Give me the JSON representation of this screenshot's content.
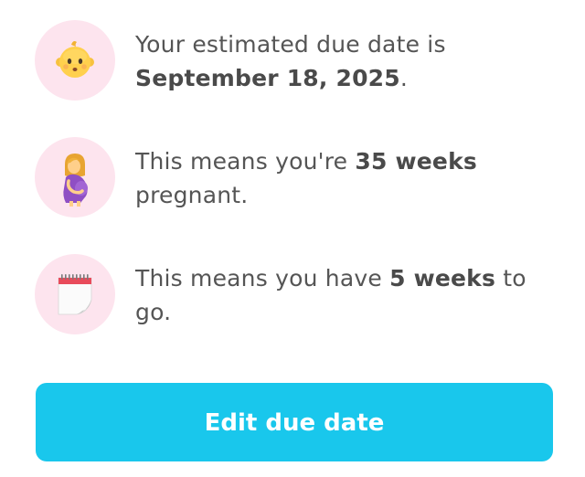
{
  "rows": [
    {
      "icon": "baby-face-icon",
      "pre": "Your estimated due date is ",
      "bold": "September 18, 2025",
      "post": "."
    },
    {
      "icon": "pregnant-woman-icon",
      "pre": "This means you're ",
      "bold": "35 weeks",
      "post": " pregnant."
    },
    {
      "icon": "calendar-icon",
      "pre": "This means you have ",
      "bold": "5 weeks",
      "post": " to go."
    }
  ],
  "button": {
    "label": "Edit due date"
  },
  "colors": {
    "icon_circle": "#fde4ee",
    "button": "#19c7ec",
    "text": "#555555"
  }
}
